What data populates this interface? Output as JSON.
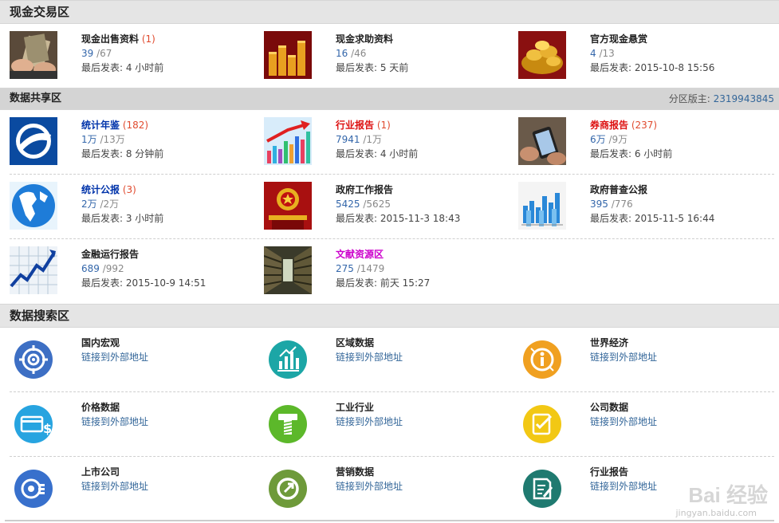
{
  "cash": {
    "title": "现金交易区",
    "forums": [
      {
        "name": "现金出售资料",
        "today": "(1)",
        "threads": "39",
        "posts": "/67",
        "last_prefix": "最后发表: ",
        "last": "4 小时前",
        "icon": "money-hands-photo"
      },
      {
        "name": "现金求助资料",
        "threads": "16",
        "posts": "/46",
        "last_prefix": "最后发表: ",
        "last": "5 天前",
        "icon": "coin-stacks-photo"
      },
      {
        "name": "官方现金悬赏",
        "threads": "4",
        "posts": "/13",
        "last_prefix": "最后发表: ",
        "last": "2015-10-8 15:56",
        "icon": "gold-ingots-photo"
      }
    ]
  },
  "share": {
    "title": "数据共享区",
    "moderator_label": "分区版主: ",
    "moderator": "2319943845",
    "forums": [
      {
        "name": "统计年鉴",
        "today": "(182)",
        "threads": "1万",
        "posts": "/13万",
        "last_prefix": "最后发表: ",
        "last": "8 分钟前",
        "icon": "stats-logo"
      },
      {
        "name": "行业报告",
        "today": "(1)",
        "threads": "7941",
        "posts": "/1万",
        "last_prefix": "最后发表: ",
        "last": "4 小时前",
        "icon": "bar-chart-arrow"
      },
      {
        "name": "券商报告",
        "today": "(237)",
        "threads": "6万",
        "posts": "/9万",
        "last_prefix": "最后发表: ",
        "last": "6 小时前",
        "icon": "tablet-hand-photo"
      },
      {
        "name": "统计公报",
        "today": "(3)",
        "threads": "2万",
        "posts": "/2万",
        "last_prefix": "最后发表: ",
        "last": "3 小时前",
        "icon": "globe"
      },
      {
        "name": "政府工作报告",
        "threads": "5425",
        "posts": "/5625",
        "last_prefix": "最后发表: ",
        "last": "2015-11-3 18:43",
        "icon": "national-emblem"
      },
      {
        "name": "政府普查公报",
        "threads": "395",
        "posts": "/776",
        "last_prefix": "最后发表: ",
        "last": "2015-11-5 16:44",
        "icon": "3d-bars"
      },
      {
        "name": "金融运行报告",
        "threads": "689",
        "posts": "/992",
        "last_prefix": "最后发表: ",
        "last": "2015-10-9 14:51",
        "icon": "stock-line"
      },
      {
        "name": "文献资源区",
        "threads": "275",
        "posts": "/1479",
        "last_prefix": "最后发表: ",
        "last": "前天 15:27",
        "icon": "library-photo"
      }
    ]
  },
  "search": {
    "title": "数据搜索区",
    "items": [
      {
        "name": "国内宏观",
        "link": "链接到外部地址",
        "icon": "target-icon",
        "color": "#3d6fc4"
      },
      {
        "name": "区域数据",
        "link": "链接到外部地址",
        "icon": "bar-chart-icon",
        "color": "#1ca6a6"
      },
      {
        "name": "世界经济",
        "link": "链接到外部地址",
        "icon": "info-globe-icon",
        "color": "#f0a020"
      },
      {
        "name": "价格数据",
        "link": "链接到外部地址",
        "icon": "card-dollar-icon",
        "color": "#27a4e0"
      },
      {
        "name": "工业行业",
        "link": "链接到外部地址",
        "icon": "screw-icon",
        "color": "#5cb82a"
      },
      {
        "name": "公司数据",
        "link": "链接到外部地址",
        "icon": "checklist-icon",
        "color": "#f2c814"
      },
      {
        "name": "上市公司",
        "link": "链接到外部地址",
        "icon": "coins-disc-icon",
        "color": "#3870cc"
      },
      {
        "name": "营销数据",
        "link": "链接到外部地址",
        "icon": "refresh-arrow-icon",
        "color": "#6e9a3a"
      },
      {
        "name": "行业报告",
        "link": "链接到外部地址",
        "icon": "document-edit-icon",
        "color": "#1f7a70"
      }
    ]
  },
  "watermark": {
    "brand": "Bai 经验",
    "url": "jingyan.baidu.com"
  }
}
